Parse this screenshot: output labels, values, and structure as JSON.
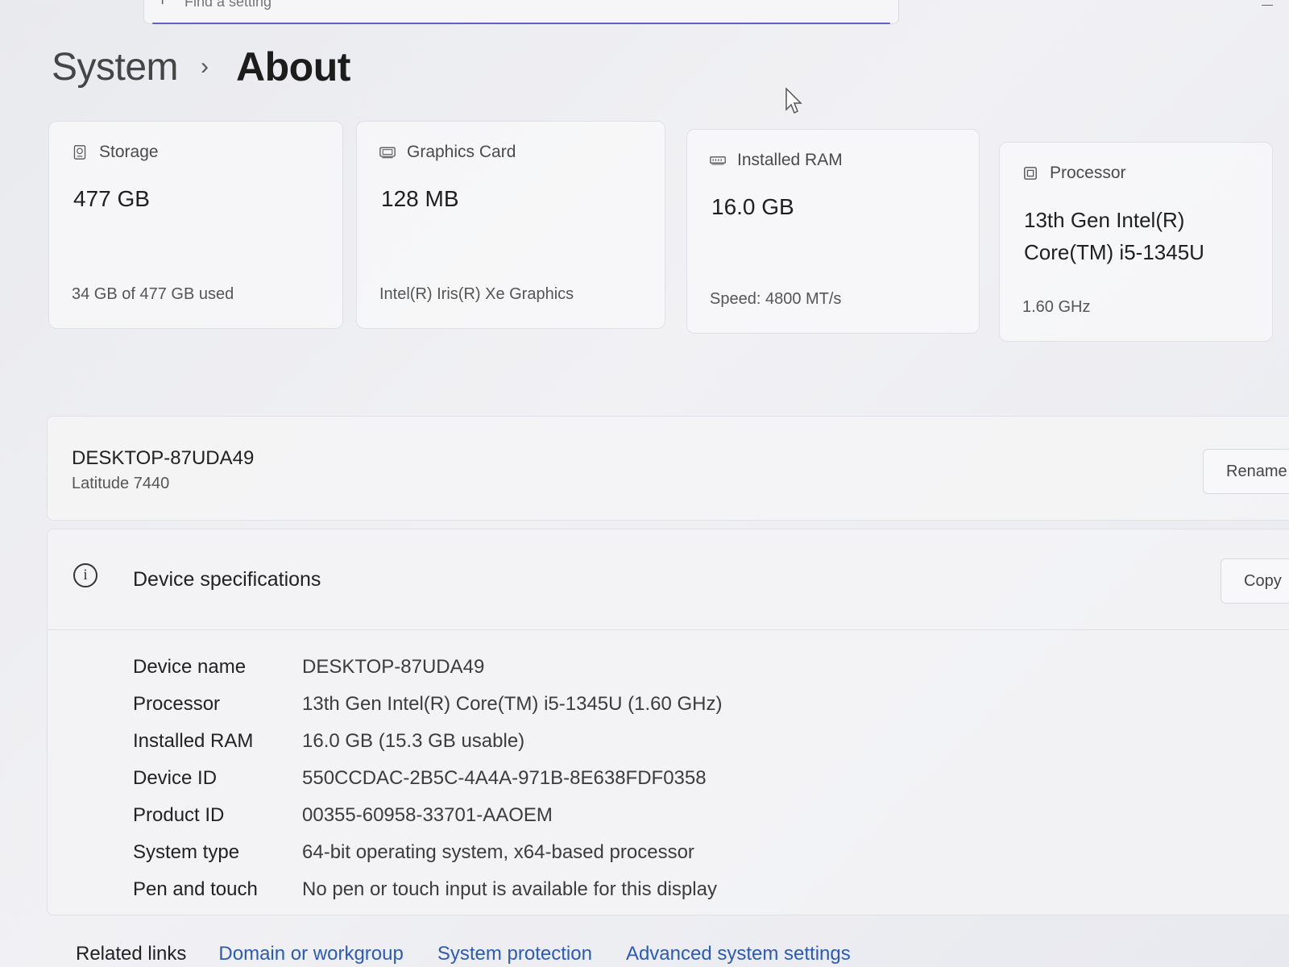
{
  "search": {
    "placeholder": "Find a setting"
  },
  "breadcrumb": {
    "parent": "System",
    "separator": "›",
    "current": "About"
  },
  "cards": [
    {
      "title": "Storage",
      "icon": "storage-icon",
      "value": "477 GB",
      "sub": "34 GB of 477 GB used"
    },
    {
      "title": "Graphics Card",
      "icon": "graphics-card-icon",
      "value": "128 MB",
      "sub": "Intel(R) Iris(R) Xe Graphics"
    },
    {
      "title": "Installed RAM",
      "icon": "ram-icon",
      "value": "16.0 GB",
      "sub": "Speed: 4800 MT/s"
    },
    {
      "title": "Processor",
      "icon": "processor-icon",
      "value": "13th Gen Intel(R) Core(TM) i5-1345U",
      "sub": "1.60 GHz"
    }
  ],
  "device": {
    "name": "DESKTOP-87UDA49",
    "model": "Latitude 7440",
    "rename_label": "Rename"
  },
  "specs": {
    "title": "Device specifications",
    "copy_label": "Copy",
    "rows": [
      {
        "label": "Device name",
        "value": "DESKTOP-87UDA49"
      },
      {
        "label": "Processor",
        "value": "13th Gen Intel(R) Core(TM) i5-1345U (1.60 GHz)"
      },
      {
        "label": "Installed RAM",
        "value": "16.0 GB (15.3 GB usable)"
      },
      {
        "label": "Device ID",
        "value": "550CCDAC-2B5C-4A4A-971B-8E638FDF0358"
      },
      {
        "label": "Product ID",
        "value": "00355-60958-33701-AAOEM"
      },
      {
        "label": "System type",
        "value": "64-bit operating system, x64-based processor"
      },
      {
        "label": "Pen and touch",
        "value": "No pen or touch input is available for this display"
      }
    ]
  },
  "related": {
    "label": "Related links",
    "links": [
      "Domain or workgroup",
      "System protection",
      "Advanced system settings"
    ]
  }
}
